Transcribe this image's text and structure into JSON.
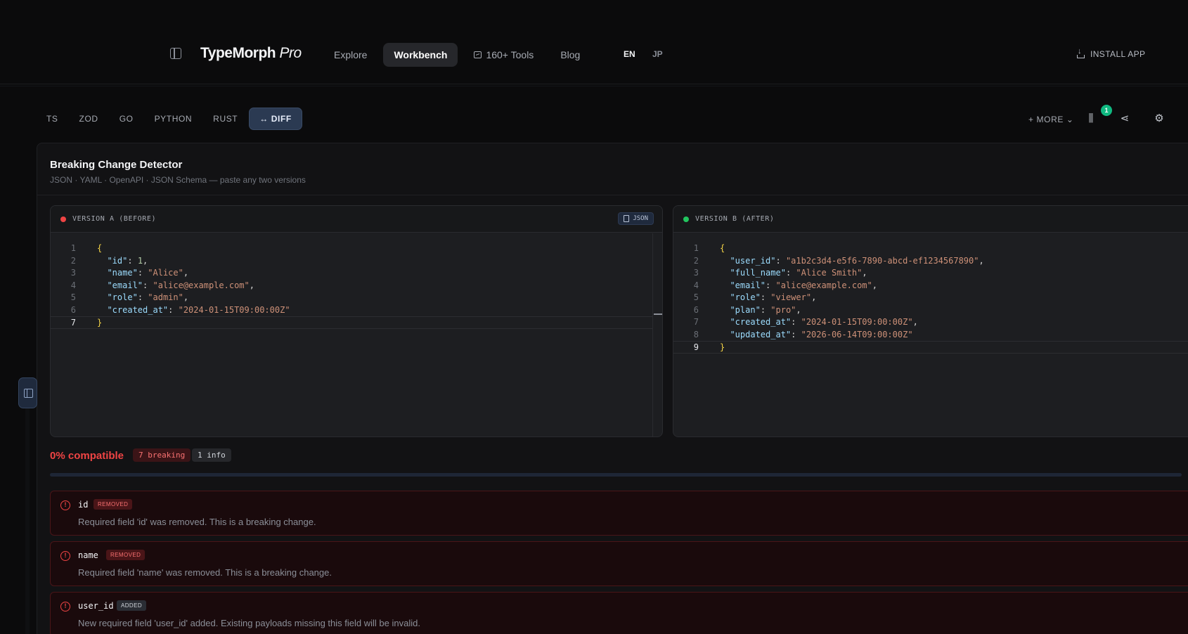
{
  "header": {
    "brand_main": "TypeMorph",
    "brand_suffix": "Pro",
    "nav": [
      {
        "label": "Explore"
      },
      {
        "label": "Workbench"
      },
      {
        "label": "160+ Tools"
      },
      {
        "label": "Blog"
      }
    ],
    "lang_en": "EN",
    "lang_jp": "JP",
    "install": "INSTALL APP"
  },
  "tabs": {
    "items": [
      "TS",
      "ZOD",
      "GO",
      "PYTHON",
      "RUST",
      "↔ DIFF"
    ],
    "more": "+ MORE",
    "library_count": "1"
  },
  "tool": {
    "title": "Breaking Change Detector",
    "subtitle": "JSON · YAML · OpenAPI · JSON Schema — paste any two versions"
  },
  "editor_a": {
    "label": "VERSION A (BEFORE)",
    "format": "JSON",
    "line_numbers": [
      "1",
      "2",
      "3",
      "4",
      "5",
      "6",
      "7"
    ]
  },
  "editor_b": {
    "label": "VERSION B (AFTER)",
    "line_numbers": [
      "1",
      "2",
      "3",
      "4",
      "5",
      "6",
      "7",
      "8",
      "9"
    ]
  },
  "summary": {
    "compat": "0% compatible",
    "breaking": "7 breaking",
    "info": "1 info"
  },
  "changes": [
    {
      "field": "id",
      "tag": "REMOVED",
      "desc": "Required field 'id' was removed. This is a breaking change."
    },
    {
      "field": "name",
      "tag": "REMOVED",
      "desc": "Required field 'name' was removed. This is a breaking change."
    },
    {
      "field": "user_id",
      "tag": "ADDED",
      "desc": "New required field 'user_id' added. Existing payloads missing this field will be invalid."
    }
  ],
  "colors": {
    "accent": "#2b3a52",
    "breaking": "#ef4444",
    "success": "#22c55e",
    "badge": "#10b981"
  }
}
